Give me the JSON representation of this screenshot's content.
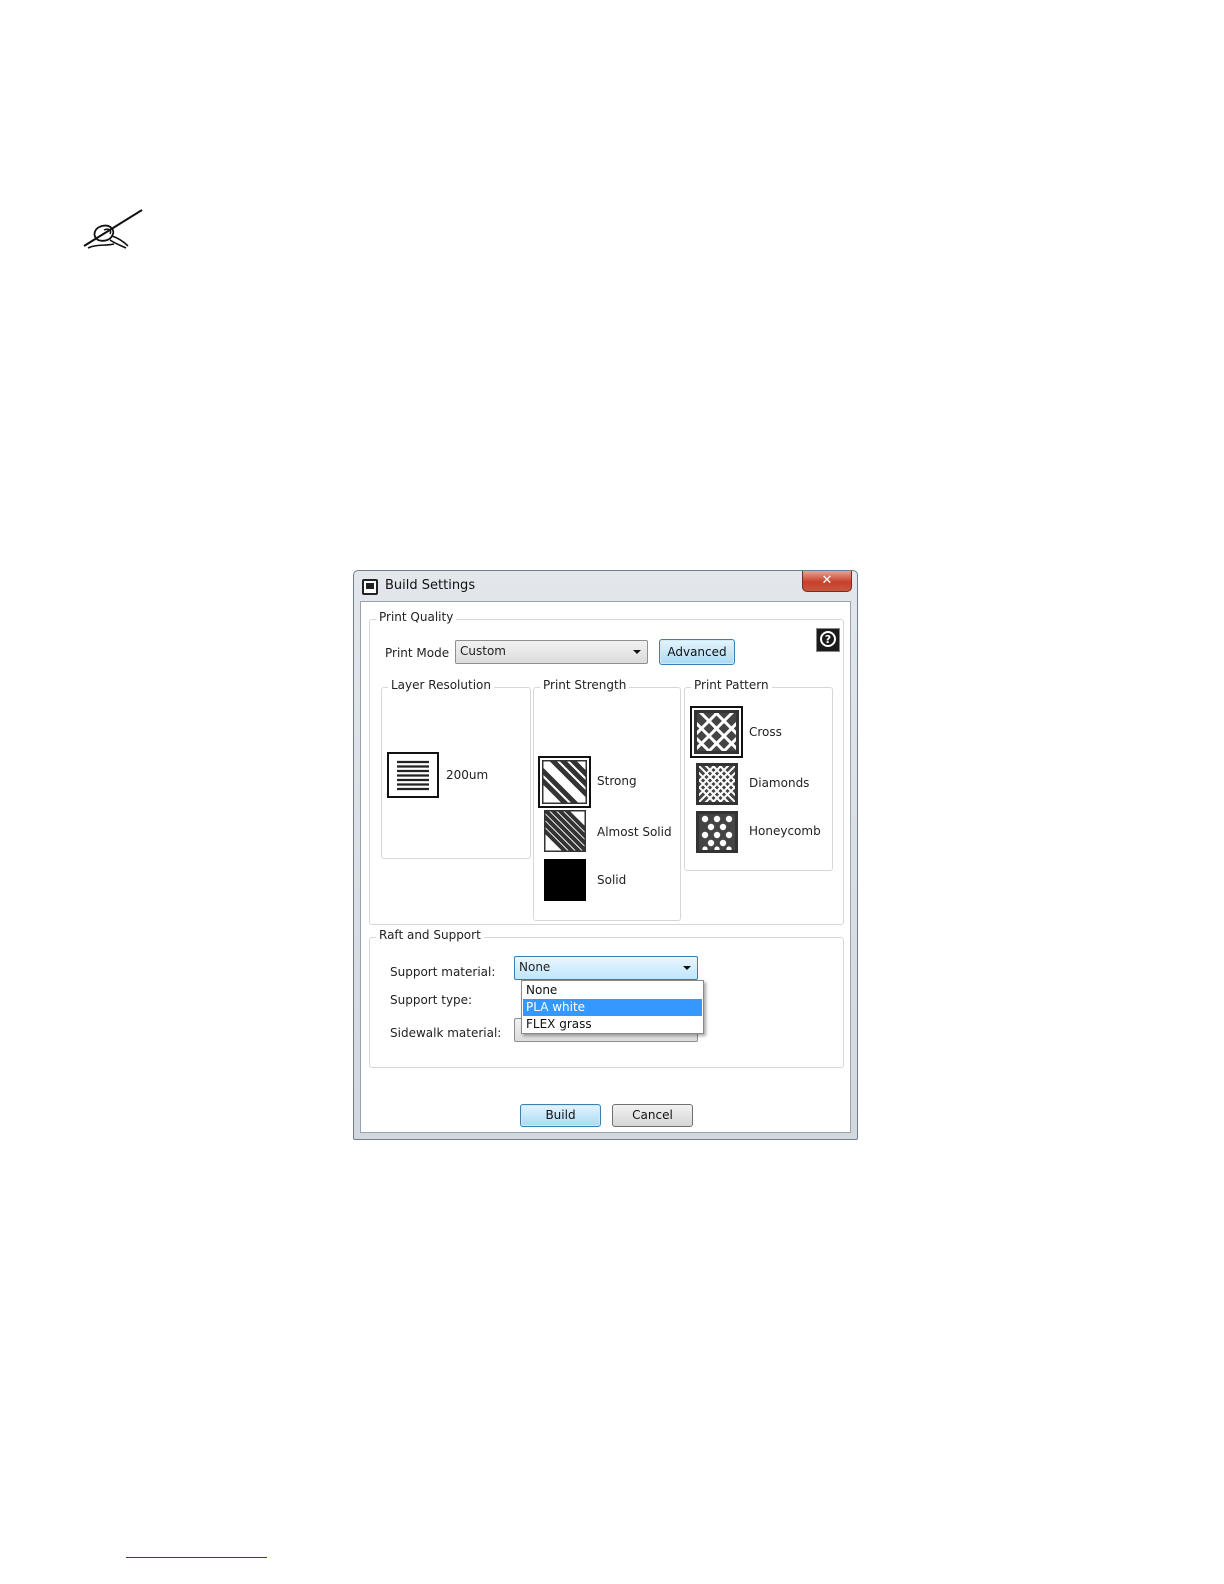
{
  "dialog": {
    "title": "Build Settings",
    "close_glyph": "✕",
    "help_icon": "help-icon",
    "print_quality": {
      "group_title": "Print Quality",
      "print_mode_label": "Print Mode",
      "print_mode_value": "Custom",
      "advanced_label": "Advanced",
      "layer_resolution": {
        "title": "Layer Resolution",
        "options": [
          {
            "label": "200um",
            "icon": "layer-lines-icon",
            "selected": true
          }
        ]
      },
      "print_strength": {
        "title": "Print Strength",
        "options": [
          {
            "label": "Strong",
            "icon": "diagonal-hatch-icon",
            "selected": true
          },
          {
            "label": "Almost Solid",
            "icon": "dense-hatch-icon",
            "selected": false
          },
          {
            "label": "Solid",
            "icon": "solid-square-icon",
            "selected": false
          }
        ]
      },
      "print_pattern": {
        "title": "Print Pattern",
        "options": [
          {
            "label": "Cross",
            "icon": "cross-grid-icon",
            "selected": true
          },
          {
            "label": "Diamonds",
            "icon": "diamond-grid-icon",
            "selected": false
          },
          {
            "label": "Honeycomb",
            "icon": "honeycomb-icon",
            "selected": false
          }
        ]
      }
    },
    "raft_support": {
      "group_title": "Raft and Support",
      "support_material_label": "Support material:",
      "support_material_value": "None",
      "support_type_label": "Support type:",
      "sidewalk_material_label": "Sidewalk material:",
      "dropdown_options": [
        "None",
        "PLA white",
        "FLEX grass"
      ],
      "highlighted_option": "PLA white"
    },
    "build_label": "Build",
    "cancel_label": "Cancel"
  },
  "page": {
    "note_icon": "handwriting-note-icon"
  },
  "colors": {
    "highlight": "#3399ff",
    "button_accent": "#a9dbf6",
    "close_button": "#c6412d"
  }
}
